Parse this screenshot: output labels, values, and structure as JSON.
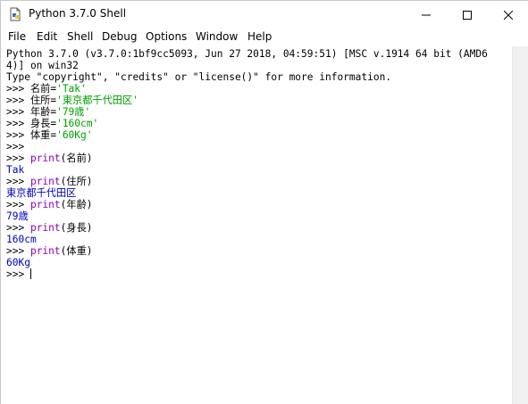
{
  "window": {
    "title": "Python 3.7.0 Shell",
    "icon": "python-idle-icon"
  },
  "menu": [
    "File",
    "Edit",
    "Shell",
    "Debug",
    "Options",
    "Window",
    "Help"
  ],
  "shell": {
    "banner1": "Python 3.7.0 (v3.7.0:1bf9cc5093, Jun 27 2018, 04:59:51) [MSC v.1914 64 bit (AMD6",
    "banner2": "4)] on win32",
    "banner3": "Type \"copyright\", \"credits\" or \"license()\" for more information.",
    "prompt": ">>> ",
    "prompt_bare": ">>>",
    "assign_name_var": "名前=",
    "assign_name_val": "'Tak'",
    "assign_addr_var": "住所=",
    "assign_addr_val": "'東京都千代田区'",
    "assign_age_var": "年齢=",
    "assign_age_val": "'79歳'",
    "assign_height_var": "身長=",
    "assign_height_val": "'160cm'",
    "assign_weight_var": "体重=",
    "assign_weight_val": "'60Kg'",
    "print_kw": "print",
    "print_name_arg": "(名前)",
    "print_addr_arg": "(住所)",
    "print_age_arg": "(年齢)",
    "print_height_arg": "(身長)",
    "print_weight_arg": "(体重)",
    "out_name": "Tak",
    "out_addr": "東京都千代田区",
    "out_age": "79歳",
    "out_height": "160cm",
    "out_weight": "60Kg"
  },
  "colors": {
    "string": "#00a000",
    "keyword": "#9000b0",
    "output": "#0000c0"
  }
}
